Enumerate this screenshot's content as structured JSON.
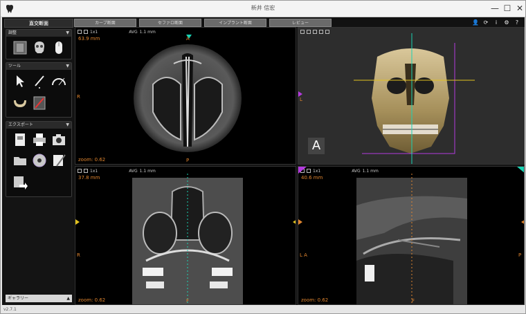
{
  "window": {
    "title": "新井 信宏",
    "minimize": "—",
    "maximize": "☐",
    "close": "✕"
  },
  "sidebar": {
    "tab_label": "直交断面",
    "panels": {
      "adjust": {
        "label": "調整"
      },
      "tools": {
        "label": "ツール"
      },
      "export": {
        "label": "エクスポート"
      }
    },
    "gallery_label": "ギャラリー"
  },
  "view_tabs": [
    "カーブ断面",
    "セファロ断面",
    "インプラント断面",
    "レビュー"
  ],
  "top_icons": [
    "user-icon",
    "refresh-icon",
    "info-icon",
    "settings-icon",
    "help-icon"
  ],
  "viewports": {
    "axial": {
      "mm": "63.9 mm",
      "zoom": "zoom: 0.62",
      "avg": "AVG",
      "slab": "1.1 mm",
      "grid": "1x1",
      "top": "A",
      "left": "R",
      "bottom": "P"
    },
    "volume": {
      "badge": "A",
      "left": "L"
    },
    "coronal": {
      "mm": "37.8 mm",
      "zoom": "zoom: 0.62",
      "avg": "AVG",
      "slab": "1.1 mm",
      "grid": "1x1",
      "left": "R",
      "bottom": "F"
    },
    "sagittal": {
      "mm": "40.6 mm",
      "zoom": "zoom: 0.62",
      "avg": "AVG",
      "slab": "1.1 mm",
      "grid": "1x1",
      "left": "L A",
      "right": "P",
      "bottom": "F"
    }
  },
  "status": {
    "text": "v2.7.1"
  },
  "colors": {
    "accent_orange": "#e0852f",
    "cyan": "#19d4b4",
    "magenta": "#b43adf",
    "yellow": "#e2c21f"
  }
}
